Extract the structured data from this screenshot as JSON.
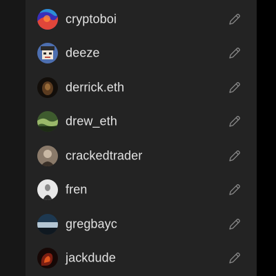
{
  "users": [
    {
      "name": "cryptoboi",
      "avatar_icon": "cryptoboi-avatar-icon",
      "colors": [
        "#3a2fb8",
        "#e0463a",
        "#2c8fd6"
      ]
    },
    {
      "name": "deeze",
      "avatar_icon": "deeze-avatar-icon",
      "colors": [
        "#4d6fb0",
        "#f0e6d8",
        "#2b2b2b"
      ]
    },
    {
      "name": "derrick.eth",
      "avatar_icon": "derrick-eth-avatar-icon",
      "colors": [
        "#120e0a",
        "#5a3b20",
        "#c08a4a"
      ]
    },
    {
      "name": "drew_eth",
      "avatar_icon": "drew-eth-avatar-icon",
      "colors": [
        "#3e5b2e",
        "#9ab86a",
        "#1d2b15"
      ]
    },
    {
      "name": "crackedtrader",
      "avatar_icon": "crackedtrader-avatar-icon",
      "colors": [
        "#8a7a6a",
        "#c9b8a4",
        "#3a3028"
      ]
    },
    {
      "name": "fren",
      "avatar_icon": "fren-avatar-icon",
      "colors": [
        "#e8e8e8",
        "#8c8c8c",
        "#303030"
      ]
    },
    {
      "name": "gregbayc",
      "avatar_icon": "gregbayc-avatar-icon",
      "colors": [
        "#1d3850",
        "#b4c6d4",
        "#0f1820"
      ]
    },
    {
      "name": "jackdude",
      "avatar_icon": "jackdude-avatar-icon",
      "colors": [
        "#7a1e12",
        "#e0561e",
        "#160806"
      ]
    }
  ],
  "edit_icon": "pencil-icon",
  "colors": {
    "background": "#171717",
    "panel": "#232323",
    "text": "#e2e2e2",
    "icon": "#8a8a8a"
  }
}
